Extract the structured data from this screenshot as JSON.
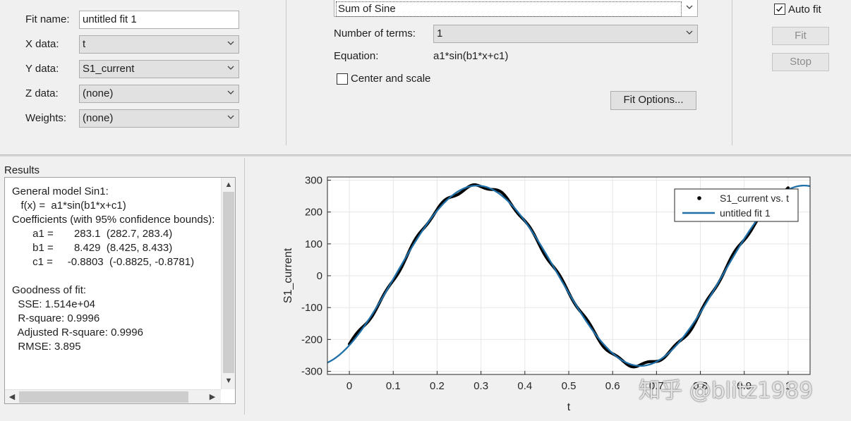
{
  "fit_panel": {
    "fit_name_label": "Fit name:",
    "fit_name_value": "untitled fit 1",
    "x_data_label": "X data:",
    "x_data_value": "t",
    "y_data_label": "Y data:",
    "y_data_value": "S1_current",
    "z_data_label": "Z data:",
    "z_data_value": "(none)",
    "weights_label": "Weights:",
    "weights_value": "(none)"
  },
  "model_panel": {
    "fit_type_value": "Sum of Sine",
    "num_terms_label": "Number of terms:",
    "num_terms_value": "1",
    "equation_label": "Equation:",
    "equation_value": "a1*sin(b1*x+c1)",
    "center_scale_label": "Center and scale",
    "center_scale_checked": false,
    "fit_options_label": "Fit Options..."
  },
  "controls": {
    "auto_fit_label": "Auto fit",
    "auto_fit_checked": true,
    "fit_button": "Fit",
    "stop_button": "Stop"
  },
  "results": {
    "title": "Results",
    "lines": [
      "General model Sin1:",
      "   f(x) =  a1*sin(b1*x+c1)",
      "Coefficients (with 95% confidence bounds):",
      "       a1 =       283.1  (282.7, 283.4)",
      "       b1 =       8.429  (8.425, 8.433)",
      "       c1 =     -0.8803  (-0.8825, -0.8781)",
      "",
      "Goodness of fit:",
      "  SSE: 1.514e+04",
      "  R-square: 0.9996",
      "  Adjusted R-square: 0.9996",
      "  RMSE: 3.895"
    ]
  },
  "chart_data": {
    "type": "line",
    "xlabel": "t",
    "ylabel": "S1_current",
    "xlim": [
      -0.05,
      1.05
    ],
    "ylim": [
      -310,
      310
    ],
    "xticks": [
      0,
      0.1,
      0.2,
      0.3,
      0.4,
      0.5,
      0.6,
      0.7,
      0.8,
      0.9,
      1
    ],
    "xtick_labels": [
      "0",
      "0.1",
      "0.2",
      "0.3",
      "0.4",
      "0.5",
      "0.6",
      "0.7",
      "0.8",
      "0.9",
      "1"
    ],
    "yticks": [
      -300,
      -200,
      -100,
      0,
      100,
      200,
      300
    ],
    "grid": true,
    "legend_position": "top-right",
    "fit_model": {
      "a1": 283.1,
      "b1": 8.429,
      "c1": -0.8803
    },
    "data_x_range": [
      0,
      1
    ],
    "series": [
      {
        "name": "S1_current vs. t",
        "style": "dots",
        "color": "#000000"
      },
      {
        "name": "untitled fit 1",
        "style": "line",
        "color": "#1f6fa8"
      }
    ]
  },
  "watermark": "知乎 @blitz1989"
}
